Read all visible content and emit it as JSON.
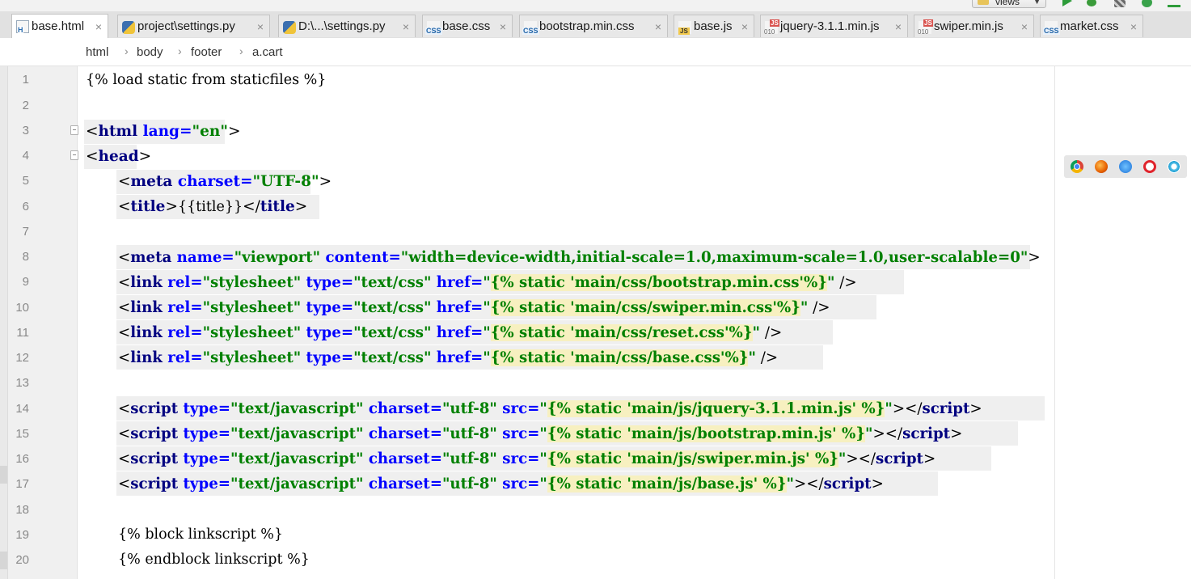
{
  "toolbar": {
    "views_label": "views"
  },
  "tabs": [
    {
      "label": "base.html",
      "icon": "html-file-icon",
      "active": true
    },
    {
      "label": "project\\settings.py",
      "icon": "python-file-icon",
      "active": false
    },
    {
      "label": "D:\\...\\settings.py",
      "icon": "python-file-icon",
      "active": false
    },
    {
      "label": "base.css",
      "icon": "css-file-icon",
      "active": false
    },
    {
      "label": "bootstrap.min.css",
      "icon": "css-file-icon",
      "active": false
    },
    {
      "label": "base.js",
      "icon": "js-file-icon",
      "active": false
    },
    {
      "label": "jquery-3.1.1.min.js",
      "icon": "minified-js-file-icon",
      "active": false
    },
    {
      "label": "swiper.min.js",
      "icon": "minified-js-file-icon",
      "active": false
    },
    {
      "label": "market.css",
      "icon": "css-file-icon",
      "active": false
    }
  ],
  "tab_close_glyph": "×",
  "breadcrumb": [
    "html",
    "body",
    "footer",
    "a.cart"
  ],
  "breadcrumb_sep": "›",
  "line_numbers": [
    "1",
    "2",
    "3",
    "4",
    "5",
    "6",
    "7",
    "8",
    "9",
    "10",
    "11",
    "12",
    "13",
    "14",
    "15",
    "16",
    "17",
    "18",
    "19",
    "20"
  ],
  "code": {
    "l1": "{% load static from staticfiles %}",
    "l3": {
      "lt": "<",
      "tag": "html",
      "attr": " lang",
      "eq": "=",
      "val": "\"en\"",
      "gt": ">"
    },
    "l4": {
      "lt": "<",
      "tag": "head",
      "gt": ">"
    },
    "l5": {
      "lt": "<",
      "tag": "meta",
      "attr": " charset",
      "eq": "=",
      "val": "\"UTF-8\"",
      "gt": ">"
    },
    "l6": {
      "lt": "<",
      "tag": "title",
      "gt": ">",
      "inner": "{{title}}",
      "close_lt": "</",
      "close_tag": "title",
      "close_gt": ">"
    },
    "l8": {
      "lt": "<",
      "tag": "meta",
      "a1": " name",
      "eq": "=",
      "v1": "\"viewport\"",
      "a2": " content",
      "v2": "\"width=device-width,initial-scale=1.0,maximum-scale=1.0,user-scalable=0\"",
      "gt": ">"
    },
    "l9": {
      "lt": "<",
      "tag": "link",
      "a1": " rel",
      "v1": "\"stylesheet\"",
      "a2": " type",
      "v2": "\"text/css\"",
      "a3": " href",
      "q1": "\"",
      "tpl": "{% static 'main/css/bootstrap.min.css'%}",
      "q2": "\"",
      "end": " />"
    },
    "l10": {
      "lt": "<",
      "tag": "link",
      "a1": " rel",
      "v1": "\"stylesheet\"",
      "a2": " type",
      "v2": "\"text/css\"",
      "a3": " href",
      "q1": "\"",
      "tpl": "{% static 'main/css/swiper.min.css'%}",
      "q2": "\"",
      "end": " />"
    },
    "l11": {
      "lt": "<",
      "tag": "link",
      "a1": " rel",
      "v1": "\"stylesheet\"",
      "a2": " type",
      "v2": "\"text/css\"",
      "a3": " href",
      "q1": "\"",
      "tpl": "{% static 'main/css/reset.css'%}",
      "q2": "\"",
      "end": " />"
    },
    "l12": {
      "lt": "<",
      "tag": "link",
      "a1": " rel",
      "v1": "\"stylesheet\"",
      "a2": " type",
      "v2": "\"text/css\"",
      "a3": " href",
      "q1": "\"",
      "tpl": "{% static 'main/css/base.css'%}",
      "q2": "\"",
      "end": " />"
    },
    "l14": {
      "lt": "<",
      "tag": "script",
      "a1": " type",
      "v1": "\"text/javascript\"",
      "a2": " charset",
      "v2": "\"utf-8\"",
      "a3": " src",
      "q1": "\"",
      "tpl": "{% static 'main/js/jquery-3.1.1.min.js' %}",
      "q2": "\"",
      "gt": ">",
      "close_lt": "</",
      "close_tag": "script",
      "close_gt": ">"
    },
    "l15": {
      "lt": "<",
      "tag": "script",
      "a1": " type",
      "v1": "\"text/javascript\"",
      "a2": " charset",
      "v2": "\"utf-8\"",
      "a3": " src",
      "q1": "\"",
      "tpl": "{% static 'main/js/bootstrap.min.js' %}",
      "q2": "\"",
      "gt": ">",
      "close_lt": "</",
      "close_tag": "script",
      "close_gt": ">"
    },
    "l16": {
      "lt": "<",
      "tag": "script",
      "a1": " type",
      "v1": "\"text/javascript\"",
      "a2": " charset",
      "v2": "\"utf-8\"",
      "a3": " src",
      "q1": "\"",
      "tpl": "{% static 'main/js/swiper.min.js' %}",
      "q2": "\"",
      "gt": ">",
      "close_lt": "</",
      "close_tag": "script",
      "close_gt": ">"
    },
    "l17": {
      "lt": "<",
      "tag": "script",
      "a1": " type",
      "v1": "\"text/javascript\"",
      "a2": " charset",
      "v2": "\"utf-8\"",
      "a3": " src",
      "q1": "\"",
      "tpl": "{% static 'main/js/base.js' %}",
      "q2": "\"",
      "gt": ">",
      "close_lt": "</",
      "close_tag": "script",
      "close_gt": ">"
    },
    "l19": "{% block linkscript %}",
    "l20": "{% endblock linkscript %}"
  },
  "eq": "=",
  "browser_icons": [
    "chrome-icon",
    "firefox-icon",
    "safari-icon",
    "opera-icon",
    "ie-icon"
  ]
}
